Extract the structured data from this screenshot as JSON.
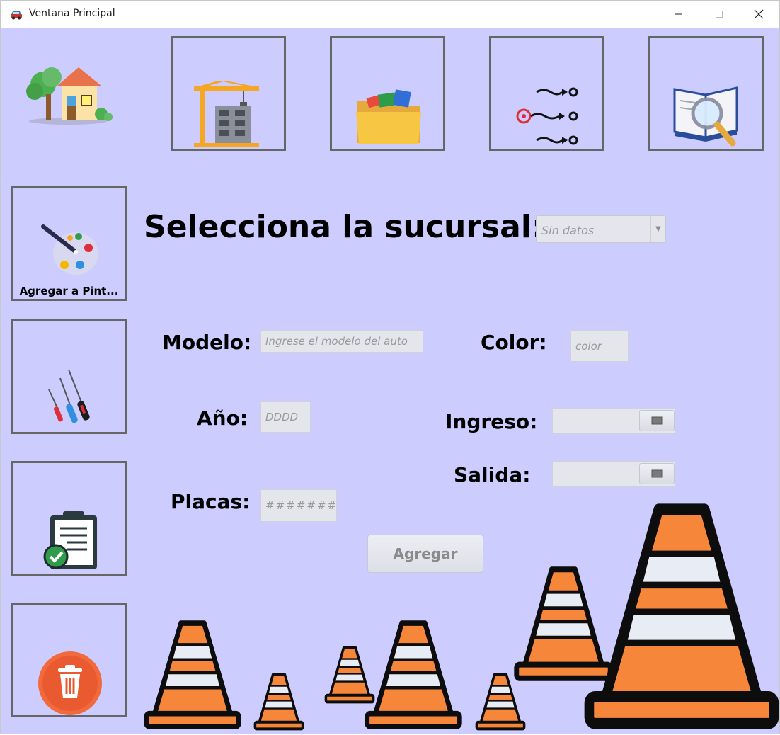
{
  "window": {
    "title": "Ventana Principal",
    "minimize_icon": "minimize-icon",
    "maximize_icon": "maximize-icon",
    "close_icon": "close-icon"
  },
  "toolbar": {
    "items": [
      {
        "icon": "home-icon"
      },
      {
        "icon": "construction-crane-icon"
      },
      {
        "icon": "folder-icon"
      },
      {
        "icon": "target-arrows-icon"
      },
      {
        "icon": "book-search-icon"
      }
    ]
  },
  "sidebar": {
    "items": [
      {
        "icon": "paint-palette-icon",
        "label": "Agregar a Pint..."
      },
      {
        "icon": "screwdrivers-icon",
        "label": ""
      },
      {
        "icon": "clipboard-check-icon",
        "label": ""
      },
      {
        "icon": "trash-icon",
        "label": ""
      }
    ]
  },
  "form": {
    "heading": "Selecciona la sucursal:",
    "sucursal_value": "Sin datos",
    "modelo_label": "Modelo:",
    "modelo_placeholder": "Ingrese el modelo del auto",
    "color_label": "Color:",
    "color_placeholder": "color",
    "anio_label": "Año:",
    "anio_placeholder": "DDDD",
    "ingreso_label": "Ingreso:",
    "salida_label": "Salida:",
    "placas_label": "Placas:",
    "placas_placeholder": "#######",
    "submit_label": "Agregar"
  },
  "colors": {
    "background": "#ccccff",
    "button_border": "#666666",
    "cone_orange": "#f5863a",
    "cone_stripe": "#e8ecf4"
  }
}
